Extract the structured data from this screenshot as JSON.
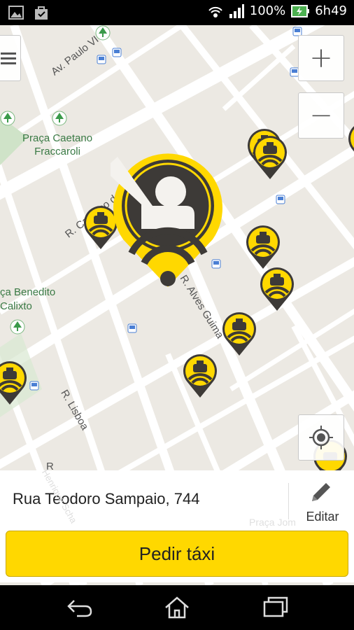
{
  "status_bar": {
    "battery": "100%",
    "time": "6h49",
    "icons": [
      "image-icon",
      "shopping-bag-icon",
      "signal-waves-icon",
      "cell-signal-icon",
      "battery-charging-icon"
    ]
  },
  "map": {
    "labels": {
      "street_paulo_vi": "Av. Paulo VI",
      "park_caetano": "Praça Caetano\nFraccaroli",
      "street_cardoso": "R. Cardoso de",
      "street_alves": "R. Alves Guima",
      "park_benedito": "ça Benedito\nCalixto",
      "street_lisboa": "R. Lisboa",
      "street_r": "R",
      "street_henrique": "Henrique Scha",
      "park_jom": "Praça Jom"
    },
    "controls": {
      "zoom_in_label": "+",
      "zoom_out_label": "−"
    }
  },
  "address_panel": {
    "address": "Rua Teodoro Sampaio, 744",
    "edit_label": "Editar",
    "order_button_label": "Pedir táxi"
  },
  "colors": {
    "brand_yellow": "#ffd800",
    "pin_dark": "#3d3a37",
    "map_bg": "#ece9e3",
    "park_green": "#3a7a45"
  },
  "nav_bar": {
    "icons": [
      "back-icon",
      "home-icon",
      "recent-apps-icon"
    ]
  }
}
